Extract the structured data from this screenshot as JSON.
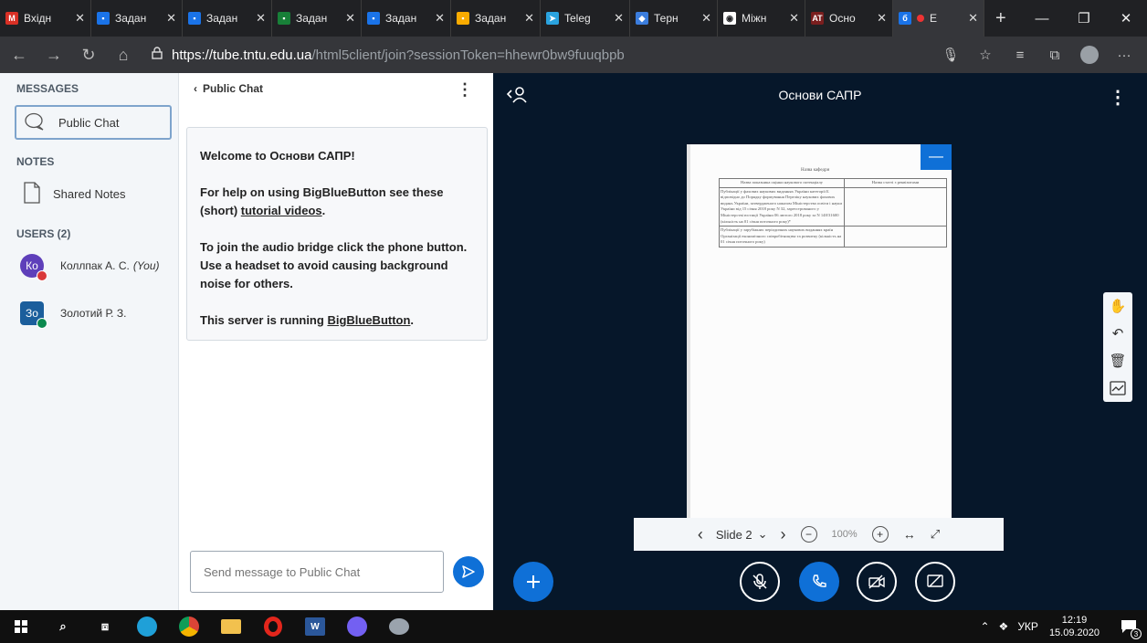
{
  "browser": {
    "tabs": [
      {
        "label": "Вхідн",
        "icon": "gmail-icon",
        "color": "#d93025",
        "glyph": "M"
      },
      {
        "label": "Задан",
        "icon": "classroom-icon",
        "color": "#1a73e8",
        "glyph": "▪"
      },
      {
        "label": "Задан",
        "icon": "classroom-icon",
        "color": "#1a73e8",
        "glyph": "▪"
      },
      {
        "label": "Задан",
        "icon": "classroom-icon",
        "color": "#188038",
        "glyph": "▪"
      },
      {
        "label": "Задан",
        "icon": "classroom-icon",
        "color": "#1a73e8",
        "glyph": "▪"
      },
      {
        "label": "Задан",
        "icon": "classroom-icon",
        "color": "#f9ab00",
        "glyph": "▪"
      },
      {
        "label": "Teleg",
        "icon": "telegram-icon",
        "color": "#2aa3df",
        "glyph": "➤"
      },
      {
        "label": "Терн",
        "icon": "moodle-icon",
        "color": "#3b7ddd",
        "glyph": "◆"
      },
      {
        "label": "Міжн",
        "icon": "eye-icon",
        "color": "#ffffff",
        "glyph": "◉"
      },
      {
        "label": "Осно",
        "icon": "at-icon",
        "color": "#7a1e1e",
        "glyph": "AT"
      },
      {
        "label": "Е",
        "icon": "bigbluebutton-icon",
        "color": "#1a73e8",
        "glyph": "б",
        "active": true
      }
    ],
    "url_host": "https://tube.tntu.edu.ua",
    "url_path": "/html5client/join?sessionToken=hhewr0bw9fuuqbpb"
  },
  "userlist": {
    "messages_title": "MESSAGES",
    "public_chat": "Public Chat",
    "notes_title": "NOTES",
    "shared_notes": "Shared Notes",
    "users_title": "USERS (2)",
    "users": [
      {
        "initials": "Ко",
        "name": "Коллпак А. С.",
        "you": "(You)",
        "color": "#5e3fba",
        "badge": "muted-mic-icon",
        "badge_color": "#d9383a"
      },
      {
        "initials": "Зо",
        "name": "Золотий Р. З.",
        "you": "",
        "color": "#1b5e9c",
        "badge": "mic-icon",
        "badge_color": "#0b8a4f"
      }
    ]
  },
  "chat": {
    "header": "Public Chat",
    "welcome_prefix": "Welcome to ",
    "welcome_title": "Основи САПР",
    "welcome_suffix": "!",
    "help_text_1": "For help on using BigBlueButton see these (short) ",
    "help_link": "tutorial videos",
    "help_text_2": ".",
    "audio_text": "To join the audio bridge click the phone button. Use a headset to avoid causing background noise for others.",
    "server_text": "This server is running ",
    "server_link": "BigBlueButton",
    "server_end": ".",
    "input_placeholder": "Send message to Public Chat"
  },
  "presentation": {
    "title": "Основи САПР",
    "slide_label": "Slide 2",
    "zoom": "100%",
    "doc_header": "Назва кафедри",
    "doc_col1": "Назва показника оцінки наукового потенціалу",
    "doc_col2": "Назва статті з реквізитами",
    "doc_row1": "Публікації у фахових наукових виданнях України категорії Б відповідно до Порядку формування Переліку наукових фахових видань України, затвердженого наказом Міністерства освіти і науки України від 15 січня 2018 року N 32, зареєстрованого у Міністерстві юстиції України 06 лютого 2018 року за N 148/31600 (кількість на 01 січня поточного року)*",
    "doc_row2": "Публікації у зарубіжних періодичних наукових виданнях країн Організації економічного співробітництва та розвитку (кількість на 01 січня поточного року)"
  },
  "taskbar": {
    "lang": "УКР",
    "time": "12:19",
    "date": "15.09.2020",
    "notifications": "3"
  }
}
